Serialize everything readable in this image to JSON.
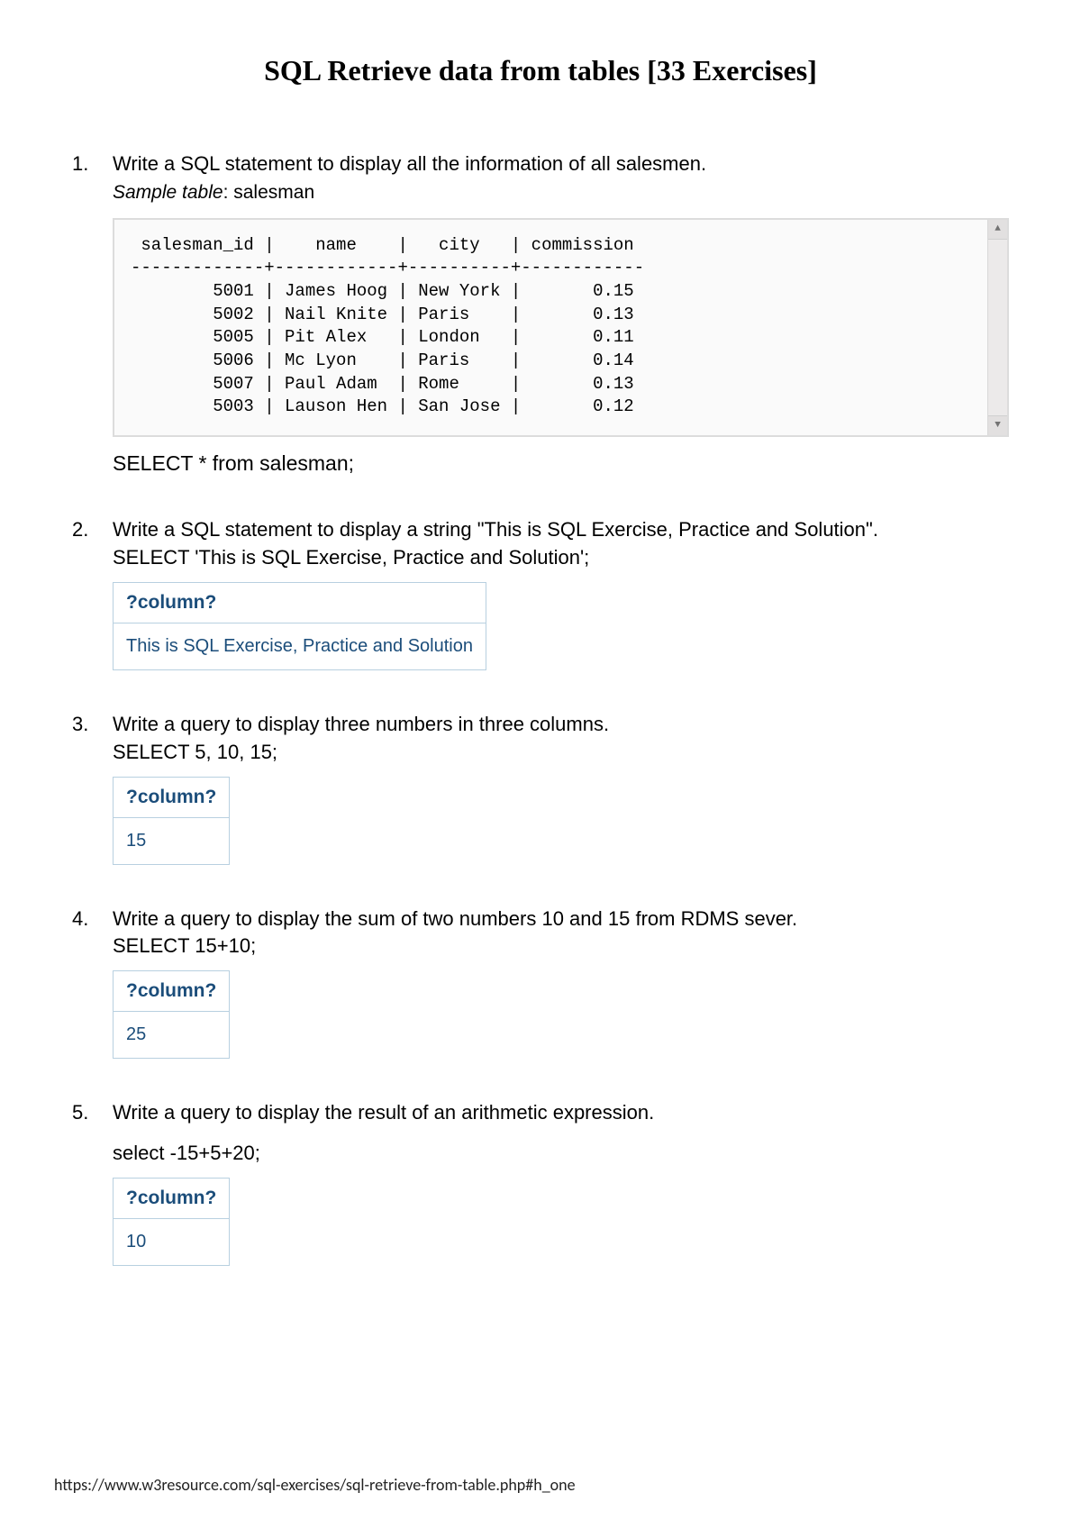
{
  "title": "SQL Retrieve data from tables [33 Exercises]",
  "footer_url": "https://www.w3resource.com/sql-exercises/sql-retrieve-from-table.php#h_one",
  "ex1": {
    "num": "1.",
    "question": "Write a SQL statement to display all the information of all salesmen.",
    "sample_label": "Sample table",
    "sample_name": ": salesman",
    "code": " salesman_id |    name    |   city   | commission\n-------------+------------+----------+------------\n        5001 | James Hoog | New York |       0.15\n        5002 | Nail Knite | Paris    |       0.13\n        5005 | Pit Alex   | London   |       0.11\n        5006 | Mc Lyon    | Paris    |       0.14\n        5007 | Paul Adam  | Rome     |       0.13\n        5003 | Lauson Hen | San Jose |       0.12",
    "answer": "SELECT * from salesman;"
  },
  "ex2": {
    "num": "2.",
    "question": "Write a SQL statement to display a string \"This is SQL Exercise, Practice and Solution\".",
    "sql": "SELECT 'This is SQL Exercise, Practice and Solution';",
    "result_header": "?column?",
    "result_value": "This is SQL Exercise, Practice and Solution"
  },
  "ex3": {
    "num": "3.",
    "question": "Write a query to display three numbers in three columns.",
    "sql": "SELECT 5, 10, 15;",
    "result_header": "?column?",
    "result_value": "15"
  },
  "ex4": {
    "num": "4.",
    "question": "Write a query to display the sum of two numbers 10 and 15 from RDMS sever.",
    "sql": "SELECT 15+10;",
    "result_header": "?column?",
    "result_value": "25"
  },
  "ex5": {
    "num": "5.",
    "question": "Write a query to display the result of an arithmetic expression.",
    "sql": "select -15+5+20;",
    "result_header": "?column?",
    "result_value": "10"
  }
}
